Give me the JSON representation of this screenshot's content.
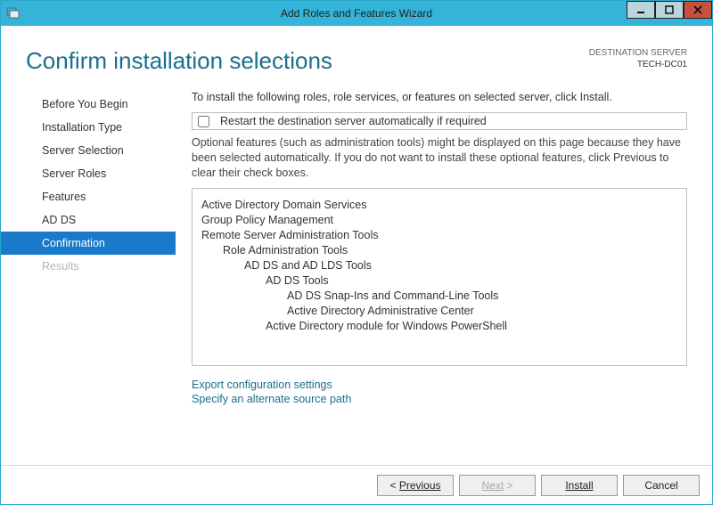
{
  "window": {
    "title": "Add Roles and Features Wizard"
  },
  "header": {
    "title": "Confirm installation selections",
    "destination_label": "DESTINATION SERVER",
    "destination_value": "TECH-DC01"
  },
  "sidebar": {
    "items": [
      {
        "label": "Before You Begin",
        "selected": false,
        "disabled": false
      },
      {
        "label": "Installation Type",
        "selected": false,
        "disabled": false
      },
      {
        "label": "Server Selection",
        "selected": false,
        "disabled": false
      },
      {
        "label": "Server Roles",
        "selected": false,
        "disabled": false
      },
      {
        "label": "Features",
        "selected": false,
        "disabled": false
      },
      {
        "label": "AD DS",
        "selected": false,
        "disabled": false
      },
      {
        "label": "Confirmation",
        "selected": true,
        "disabled": false
      },
      {
        "label": "Results",
        "selected": false,
        "disabled": true
      }
    ]
  },
  "main": {
    "intro": "To install the following roles, role services, or features on selected server, click Install.",
    "restart_checkbox_label": "Restart the destination server automatically if required",
    "restart_checked": false,
    "description": "Optional features (such as administration tools) might be displayed on this page because they have been selected automatically. If you do not want to install these optional features, click Previous to clear their check boxes.",
    "features": [
      {
        "level": 0,
        "text": "Active Directory Domain Services"
      },
      {
        "level": 0,
        "text": "Group Policy Management"
      },
      {
        "level": 0,
        "text": "Remote Server Administration Tools"
      },
      {
        "level": 1,
        "text": "Role Administration Tools"
      },
      {
        "level": 2,
        "text": "AD DS and AD LDS Tools"
      },
      {
        "level": 3,
        "text": "AD DS Tools"
      },
      {
        "level": 4,
        "text": "AD DS Snap-Ins and Command-Line Tools"
      },
      {
        "level": 4,
        "text": "Active Directory Administrative Center"
      },
      {
        "level": 3,
        "text": "Active Directory module for Windows PowerShell"
      }
    ],
    "links": {
      "export": "Export configuration settings",
      "source": "Specify an alternate source path"
    }
  },
  "footer": {
    "previous": "Previous",
    "next": "Next",
    "install": "Install",
    "cancel": "Cancel",
    "next_enabled": false
  }
}
